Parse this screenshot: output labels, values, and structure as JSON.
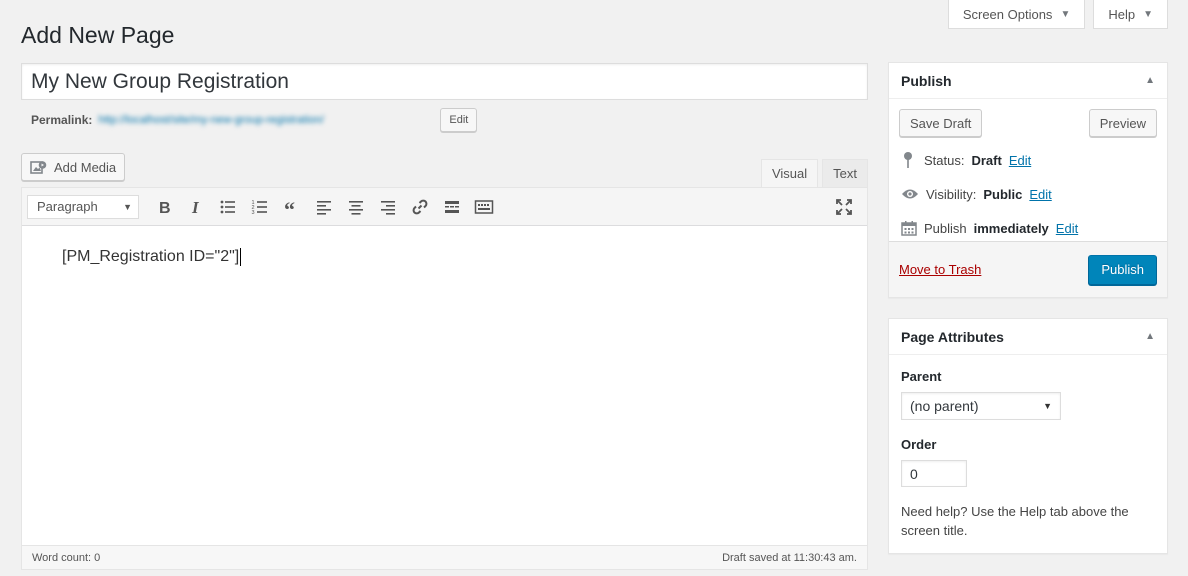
{
  "screen_meta": {
    "screen_options": "Screen Options",
    "help": "Help"
  },
  "page_title": "Add New Page",
  "title_field": {
    "value": "My New Group Registration"
  },
  "permalink": {
    "label": "Permalink:",
    "url": "http://localhost/site/my-new-group-registration/",
    "edit_label": "Edit"
  },
  "add_media": "Add Media",
  "editor_tabs": {
    "visual": "Visual",
    "text": "Text"
  },
  "toolbar": {
    "format": "Paragraph"
  },
  "content": {
    "text": "[PM_Registration ID=\"2\"]"
  },
  "status_bar": {
    "word_count": "Word count: 0",
    "draft_saved": "Draft saved at 11:30:43 am."
  },
  "publish_box": {
    "title": "Publish",
    "save_draft": "Save Draft",
    "preview": "Preview",
    "status_label": "Status:",
    "status_value": "Draft",
    "visibility_label": "Visibility:",
    "visibility_value": "Public",
    "publish_label": "Publish",
    "publish_value": "immediately",
    "edit": "Edit",
    "move_to_trash": "Move to Trash",
    "publish_button": "Publish"
  },
  "page_attributes": {
    "title": "Page Attributes",
    "parent_label": "Parent",
    "parent_value": "(no parent)",
    "order_label": "Order",
    "order_value": "0",
    "help_text": "Need help? Use the Help tab above the screen title."
  },
  "colors": {
    "primary": "#0085ba",
    "link": "#0073aa",
    "trash": "#aa0000",
    "background": "#f1f1f1"
  }
}
